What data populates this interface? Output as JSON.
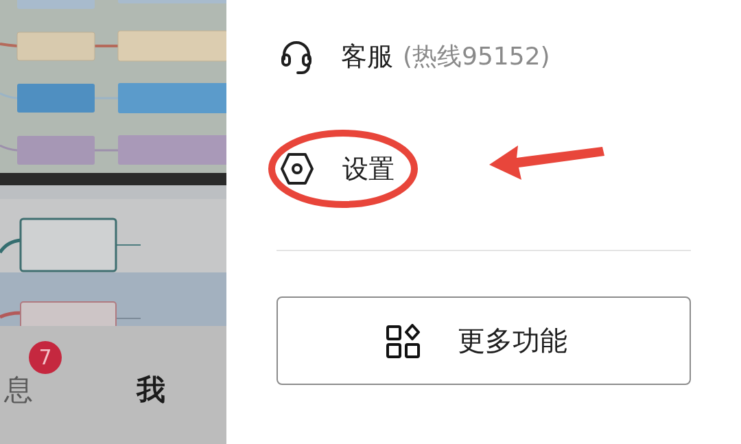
{
  "tab_bar": {
    "tabs": [
      {
        "label": "息",
        "badge": "7",
        "selected": false
      },
      {
        "label": "我",
        "selected": true
      }
    ]
  },
  "drawer": {
    "items": [
      {
        "kind": "headset",
        "label": "客服",
        "note": "(热线95152)",
        "circled": false
      },
      {
        "kind": "settings",
        "label": "设置",
        "circled": true
      }
    ],
    "more_button": {
      "label": "更多功能"
    }
  }
}
